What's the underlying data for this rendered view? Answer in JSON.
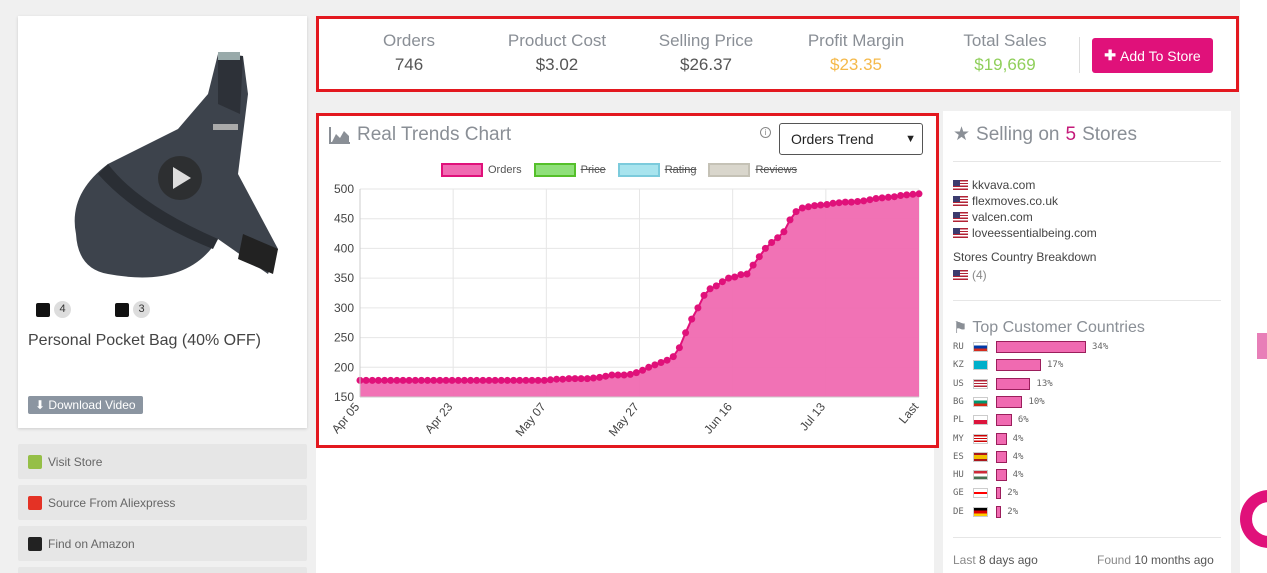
{
  "product": {
    "image_alt": "Crossbody sling pocket bag",
    "shopify_count": "4",
    "woo_count": "3",
    "title": "Personal Pocket Bag (40% OFF)",
    "download_label": "Download Video"
  },
  "side_links": [
    {
      "label": "Visit Store",
      "icon": "shopify-icon"
    },
    {
      "label": "Source From Aliexpress",
      "icon": "aliexpress-icon"
    },
    {
      "label": "Find on Amazon",
      "icon": "amazon-icon"
    }
  ],
  "stats": [
    {
      "label": "Orders",
      "value": "746",
      "tone": "default"
    },
    {
      "label": "Product Cost",
      "value": "$3.02",
      "tone": "default"
    },
    {
      "label": "Selling Price",
      "value": "$26.37",
      "tone": "default"
    },
    {
      "label": "Profit Margin",
      "value": "$23.35",
      "tone": "orange"
    },
    {
      "label": "Total Sales",
      "value": "$19,669",
      "tone": "green"
    }
  ],
  "add_to_store_label": "Add To Store",
  "chart_panel": {
    "title": "Real Trends Chart",
    "select_value": "Orders Trend",
    "legend": [
      {
        "label": "Orders",
        "fill": "#f06ab1",
        "stroke": "#e0117a",
        "active": true
      },
      {
        "label": "Price",
        "fill": "#8fe07a",
        "stroke": "#55c02a",
        "active": false
      },
      {
        "label": "Rating",
        "fill": "#a8e4ee",
        "stroke": "#7ccbdc",
        "active": false
      },
      {
        "label": "Reviews",
        "fill": "#d9d6cc",
        "stroke": "#c5c2b6",
        "active": false
      }
    ]
  },
  "chart_data": {
    "type": "area",
    "x_tick_labels": [
      "Apr 05",
      "Apr 23",
      "May 07",
      "May 27",
      "Jun 16",
      "Jul 13",
      "Last"
    ],
    "y_ticks": [
      150,
      200,
      250,
      300,
      350,
      400,
      450,
      500
    ],
    "ylim": [
      150,
      500
    ],
    "series": [
      {
        "name": "Orders",
        "color": "#e0117a",
        "fill": "#f06ab1",
        "values": [
          178,
          178,
          178,
          178,
          178,
          178,
          178,
          178,
          178,
          178,
          178,
          178,
          178,
          178,
          178,
          178,
          178,
          178,
          178,
          178,
          178,
          178,
          178,
          178,
          178,
          178,
          178,
          178,
          178,
          178,
          178,
          179,
          180,
          180,
          181,
          181,
          181,
          181,
          182,
          183,
          185,
          187,
          187,
          187,
          188,
          191,
          195,
          200,
          204,
          208,
          212,
          218,
          233,
          258,
          281,
          300,
          321,
          332,
          337,
          344,
          350,
          352,
          356,
          357,
          372,
          386,
          400,
          410,
          418,
          428,
          448,
          462,
          468,
          470,
          472,
          473,
          474,
          476,
          477,
          478,
          478,
          479,
          480,
          482,
          484,
          485,
          486,
          487,
          489,
          490,
          491,
          492
        ]
      }
    ]
  },
  "selling": {
    "prefix": "Selling on",
    "count": "5",
    "suffix": "Stores",
    "stores": [
      "kkvava.com",
      "flexmoves.co.uk",
      "valcen.com",
      "loveessentialbeing.com"
    ],
    "breakdown_title": "Stores Country Breakdown",
    "breakdown_value": "(4)"
  },
  "top_countries": {
    "title": "Top Customer Countries",
    "rows": [
      {
        "code": "RU",
        "pct": 34,
        "label": "34%",
        "flag": "ru"
      },
      {
        "code": "KZ",
        "pct": 17,
        "label": "17%",
        "flag": "kz"
      },
      {
        "code": "US",
        "pct": 13,
        "label": "13%",
        "flag": "us"
      },
      {
        "code": "BG",
        "pct": 10,
        "label": "10%",
        "flag": "bg"
      },
      {
        "code": "PL",
        "pct": 6,
        "label": "6%",
        "flag": "pl"
      },
      {
        "code": "MY",
        "pct": 4,
        "label": "4%",
        "flag": "my"
      },
      {
        "code": "ES",
        "pct": 4,
        "label": "4%",
        "flag": "es"
      },
      {
        "code": "HU",
        "pct": 4,
        "label": "4%",
        "flag": "hu"
      },
      {
        "code": "GE",
        "pct": 2,
        "label": "2%",
        "flag": "ge"
      },
      {
        "code": "DE",
        "pct": 2,
        "label": "2%",
        "flag": "de"
      }
    ]
  },
  "footer": {
    "last_label": "Last",
    "last_value": "8 days ago",
    "found_label": "Found",
    "found_value": "10 months ago"
  }
}
